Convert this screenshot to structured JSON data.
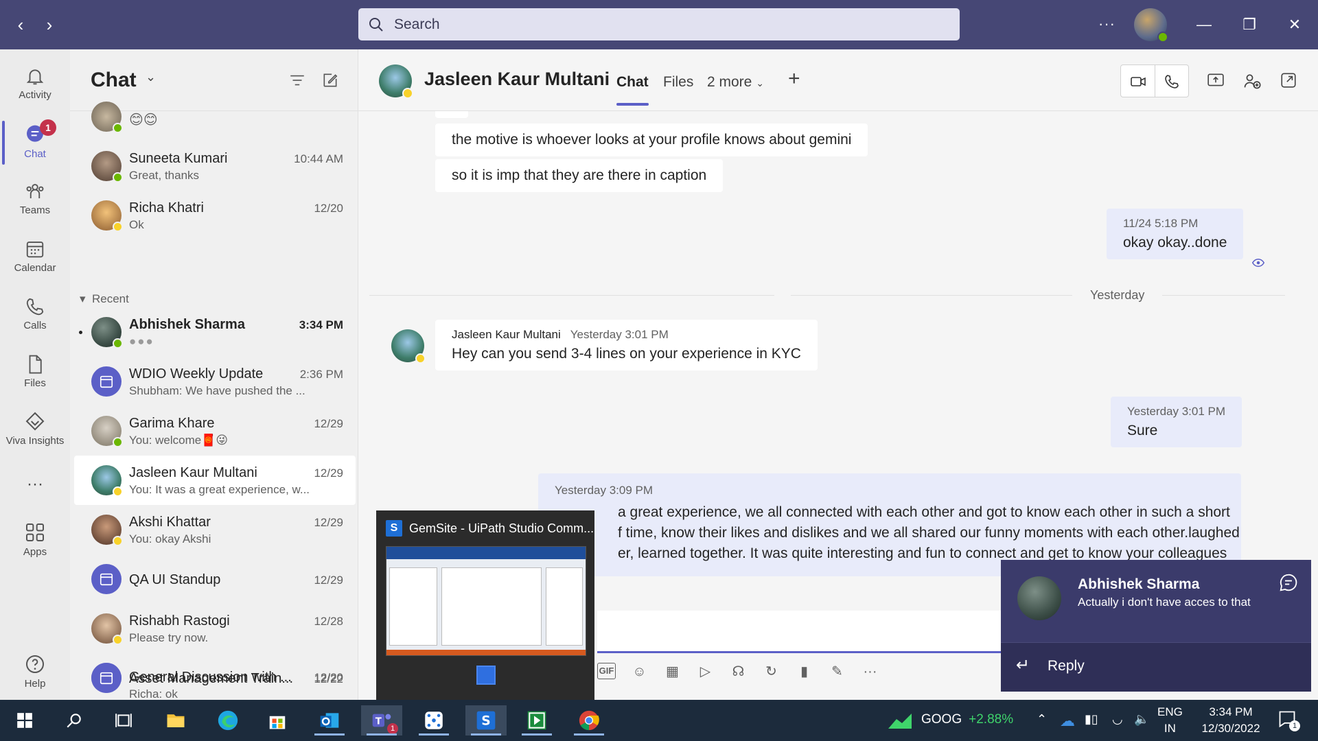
{
  "titlebar": {
    "search_placeholder": "Search",
    "more": "···"
  },
  "rail": {
    "items": [
      {
        "label": "Activity",
        "icon": "bell-icon"
      },
      {
        "label": "Chat",
        "icon": "chat-icon",
        "badge": "1"
      },
      {
        "label": "Teams",
        "icon": "teams-icon"
      },
      {
        "label": "Calendar",
        "icon": "calendar-icon"
      },
      {
        "label": "Calls",
        "icon": "phone-icon"
      },
      {
        "label": "Files",
        "icon": "file-icon"
      },
      {
        "label": "Viva Insights",
        "icon": "viva-insights-icon"
      },
      {
        "label": "···",
        "icon": "more-icon"
      },
      {
        "label": "Apps",
        "icon": "apps-icon"
      },
      {
        "label": "Help",
        "icon": "help-icon"
      }
    ]
  },
  "chatlist": {
    "title": "Chat",
    "recent_label": "Recent",
    "pinned": [
      {
        "name": "",
        "preview": "😊😊",
        "time": "",
        "status": "green"
      },
      {
        "name": "Suneeta Kumari",
        "preview": "Great, thanks",
        "time": "10:44 AM",
        "status": "green"
      },
      {
        "name": "Richa Khatri",
        "preview": "Ok",
        "time": "12/20",
        "status": "yellow"
      }
    ],
    "recent": [
      {
        "name": "Abhishek Sharma",
        "preview": "●●●",
        "time": "3:34 PM",
        "status": "green",
        "unread": true
      },
      {
        "name": "WDIO Weekly Update",
        "preview": "Shubham: We have pushed the ...",
        "time": "2:36 PM",
        "meeting": true
      },
      {
        "name": "Garima Khare",
        "preview": "You: welcome🧧😜",
        "time": "12/29",
        "status": "green"
      },
      {
        "name": "Jasleen Kaur Multani",
        "preview": "You: It was a great experience, w...",
        "time": "12/29",
        "status": "yellow",
        "selected": true
      },
      {
        "name": "Akshi Khattar",
        "preview": "You: okay Akshi",
        "time": "12/29",
        "status": "yellow"
      },
      {
        "name": "QA UI Standup",
        "preview": "",
        "time": "12/29",
        "meeting": true
      },
      {
        "name": "Rishabh Rastogi",
        "preview": "Please try now.",
        "time": "12/28",
        "status": "yellow"
      },
      {
        "name": "Asset Management Train...",
        "preview": "",
        "time": "12/22",
        "meeting": true
      },
      {
        "name": "General Discussion with ...",
        "preview": "Richa: ok",
        "time": "12/20",
        "meeting": true
      }
    ]
  },
  "header": {
    "name": "Jasleen Kaur Multani",
    "tabs": [
      "Chat",
      "Files",
      "2 more"
    ],
    "add": "+"
  },
  "messages": {
    "m1": "the motive is whoever looks at your profile knows about gemini",
    "m2": "so it is imp that they are there in caption",
    "m3_time": "11/24 5:18 PM",
    "m3_text": "okay okay..done",
    "divider": "Yesterday",
    "m4_sender": "Jasleen Kaur Multani",
    "m4_time": "Yesterday 3:01 PM",
    "m4_text": "Hey can you send 3-4 lines on your experience in KYC",
    "m5_time": "Yesterday 3:01 PM",
    "m5_text": "Sure",
    "m6_time": "Yesterday 3:09 PM",
    "m6_line1": "a great experience, we all connected with each other and got to know each other in such a short",
    "m6_line2": "f time, know their likes and dislikes and we all shared our funny moments with each other.laughed",
    "m6_line3": "er, learned together. It was quite interesting and fun to connect and get to know your colleagues"
  },
  "preview": {
    "title": "GemSite - UiPath Studio Comm..."
  },
  "toast": {
    "name": "Abhishek Sharma",
    "message": "Actually i don't have acces to that",
    "reply": "Reply"
  },
  "taskbar": {
    "stock_symbol": "GOOG",
    "stock_change": "+2.88%",
    "lang_1": "ENG",
    "lang_2": "IN",
    "time": "3:34 PM",
    "date": "12/30/2022",
    "notif_count": "1"
  },
  "colors": {
    "titlebar": "#464775",
    "accent": "#5b5fc7",
    "available": "#6bb700",
    "away": "#f8d22a",
    "badge": "#c4314b"
  }
}
